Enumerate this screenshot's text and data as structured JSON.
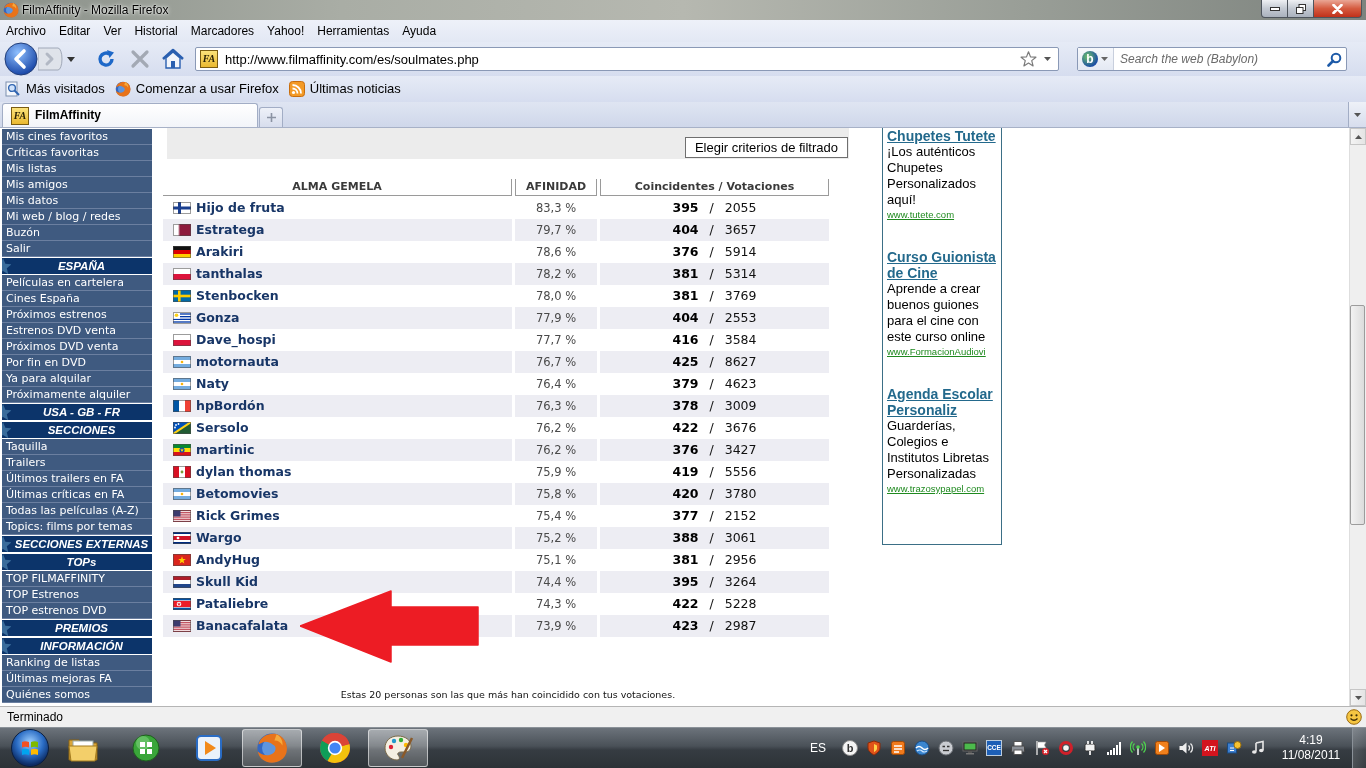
{
  "window": {
    "title": "FilmAffinity - Mozilla Firefox"
  },
  "menu_bar": [
    "Archivo",
    "Editar",
    "Ver",
    "Historial",
    "Marcadores",
    "Yahoo!",
    "Herramientas",
    "Ayuda"
  ],
  "address_bar": {
    "site_icon": "FA",
    "url": "http://www.filmaffinity.com/es/soulmates.php"
  },
  "search_box": {
    "engine_icon": "b",
    "placeholder": "Search the web (Babylon)"
  },
  "bookmarks": [
    {
      "kind": "smart",
      "label": "Más visitados"
    },
    {
      "kind": "firefox",
      "label": "Comenzar a usar Firefox"
    },
    {
      "kind": "feed",
      "label": "Últimas noticias"
    }
  ],
  "tabs": [
    {
      "icon": "FA",
      "label": "FilmAffinity",
      "selected": true
    }
  ],
  "sidebar": [
    {
      "items": [
        "Mis cines favoritos",
        "Críticas favoritas",
        "Mis listas",
        "Mis amigos",
        "Mis datos",
        "Mi web / blog / redes",
        "Buzón",
        "Salir"
      ]
    },
    {
      "heading": "ESPAÑA",
      "items": [
        "Películas en cartelera",
        "Cines España",
        "Próximos estrenos",
        "Estrenos DVD venta",
        "Próximos DVD venta",
        "Por fin en DVD",
        "Ya para alquilar",
        "Próximamente alquiler"
      ]
    },
    {
      "heading": "USA - GB - FR"
    },
    {
      "heading": "SECCIONES",
      "items": [
        "Taquilla",
        "Trailers",
        "Últimos trailers en FA",
        "Últimas críticas en FA",
        "Todas las películas (A-Z)",
        "Topics: films por temas"
      ]
    },
    {
      "heading": "SECCIONES EXTERNAS"
    },
    {
      "heading": "TOPs",
      "items": [
        "TOP FILMAFFINITY",
        "TOP Estrenos",
        "TOP estrenos DVD"
      ]
    },
    {
      "heading": "PREMIOS"
    },
    {
      "heading": "INFORMACIÓN",
      "items": [
        "Ranking de listas",
        "Últimas mejoras FA",
        "Quiénes somos"
      ]
    }
  ],
  "filter": {
    "button": "Elegir criterios de filtrado"
  },
  "table": {
    "columns": [
      "ALMA GEMELA",
      "AFINIDAD",
      "Coincidentes / Votaciones"
    ],
    "rows": [
      {
        "kind": "finland",
        "name": "Hijo de fruta",
        "affinity": "83,3 %",
        "coincidences": "**395** / 2055",
        "marked": false
      },
      {
        "kind": "qatar",
        "name": "Estratega",
        "affinity": "79,7 %",
        "coincidences": "**404** / 3657",
        "marked": false
      },
      {
        "kind": "germany",
        "name": "Arakiri",
        "affinity": "78,6 %",
        "coincidences": "**376** / 5914",
        "marked": false
      },
      {
        "kind": "poland",
        "name": "tanthalas",
        "affinity": "78,2 %",
        "coincidences": "**381** / 5314",
        "marked": false
      },
      {
        "kind": "sweden",
        "name": "Stenbocken",
        "affinity": "78,0 %",
        "coincidences": "**381** / 3769",
        "marked": false
      },
      {
        "kind": "uruguay",
        "name": "Gonza",
        "affinity": "77,9 %",
        "coincidences": "**404** / 2553",
        "marked": false
      },
      {
        "kind": "poland",
        "name": "Dave_hospi",
        "affinity": "77,7 %",
        "coincidences": "**416** / 3584",
        "marked": false
      },
      {
        "kind": "argentina",
        "name": "motornauta",
        "affinity": "76,7 %",
        "coincidences": "**425** / 8627",
        "marked": false
      },
      {
        "kind": "argentina",
        "name": "Naty",
        "affinity": "76,4 %",
        "coincidences": "**379** / 4623",
        "marked": false
      },
      {
        "kind": "france",
        "name": "hpBordón",
        "affinity": "76,3 %",
        "coincidences": "**378** / 3009",
        "marked": false
      },
      {
        "kind": "solomon",
        "name": "Sersolo",
        "affinity": "76,2 %",
        "coincidences": "**422** / 3676",
        "marked": false
      },
      {
        "kind": "ethiopia",
        "name": "martinic",
        "affinity": "76,2 %",
        "coincidences": "**376** / 3427",
        "marked": false
      },
      {
        "kind": "peru",
        "name": "dylan thomas",
        "affinity": "75,9 %",
        "coincidences": "**419** / 5556",
        "marked": false
      },
      {
        "kind": "argentina",
        "name": "Betomovies",
        "affinity": "75,8 %",
        "coincidences": "**420** / 3780",
        "marked": false
      },
      {
        "kind": "usa",
        "name": "Rick Grimes",
        "affinity": "75,4 %",
        "coincidences": "**377** / 2152",
        "marked": false
      },
      {
        "kind": "costarica",
        "name": "Wargo",
        "affinity": "75,2 %",
        "coincidences": "**388** / 3061",
        "marked": false
      },
      {
        "kind": "vietnam",
        "name": "AndyHug",
        "affinity": "75,1 %",
        "coincidences": "**381** / 2956",
        "marked": false
      },
      {
        "kind": "netherlands",
        "name": "Skull Kid",
        "affinity": "74,4 %",
        "coincidences": "**395** / 3264",
        "marked": false
      },
      {
        "kind": "northkorea",
        "name": "Pataliebre",
        "affinity": "74,3 %",
        "coincidences": "**422** / 5228",
        "marked": false
      },
      {
        "kind": "usa",
        "name": "Banacafalata",
        "affinity": "73,9 %",
        "coincidences": "**423** / 2987",
        "marked": true
      }
    ]
  },
  "note": "Estas 20 personas son las que más han coincidido con tus votaciones.",
  "ads": [
    {
      "title": "Chupetes Tutete",
      "text": "¡Los auténticos Chupetes Personalizados aquí!",
      "url": "www.tutete.com"
    },
    {
      "title": "Curso Guionista de Cine",
      "text": "Aprende a crear buenos guiones para el cine con este curso online",
      "url": "www.FormacionAudiovi"
    },
    {
      "title": "Agenda Escolar Personaliz",
      "text": "Guarderías, Colegios e Institutos Libretas Personalizadas",
      "url": "www.trazosypapel.com"
    }
  ],
  "status_bar": {
    "text": "Terminado"
  },
  "taskbar": {
    "apps": [
      {
        "kind": "folder",
        "running": false
      },
      {
        "kind": "orb",
        "running": false
      },
      {
        "kind": "media",
        "running": false
      },
      {
        "kind": "firefox",
        "running": true
      },
      {
        "kind": "chrome",
        "running": false
      },
      {
        "kind": "paint",
        "running": true
      }
    ],
    "language": "ES",
    "tray_labels": [
      "b",
      "CCE",
      "ATI"
    ],
    "time": "4:19",
    "date": "11/08/2011"
  }
}
